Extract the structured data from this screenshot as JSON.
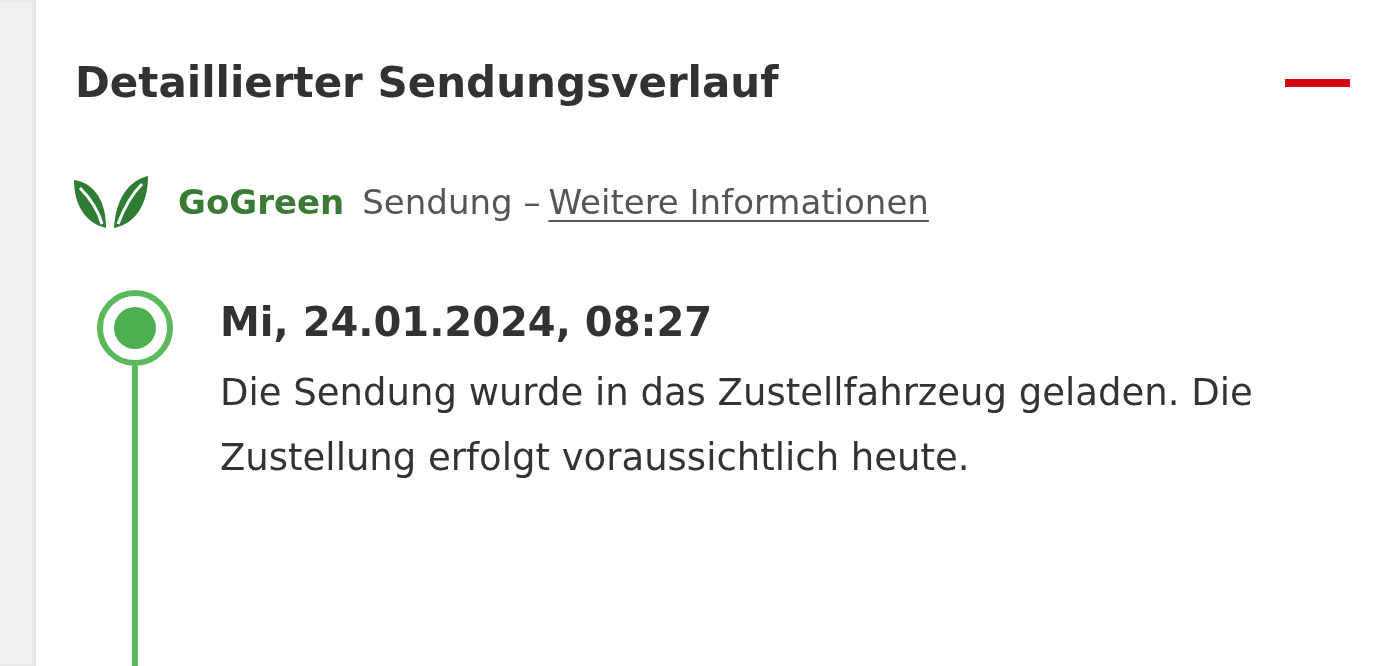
{
  "section": {
    "title": "Detaillierter Sendungsverlauf",
    "expanded": true
  },
  "gogreen": {
    "brand": "GoGreen",
    "text": "Sendung –",
    "link": "Weitere Informationen"
  },
  "events": [
    {
      "date": "Mi, 24.01.2024, 08:27",
      "text": "Die Sendung wurde in das Zustellfahrzeug geladen. Die Zustellung erfolgt voraussichtlich heute.",
      "current": true
    }
  ]
}
